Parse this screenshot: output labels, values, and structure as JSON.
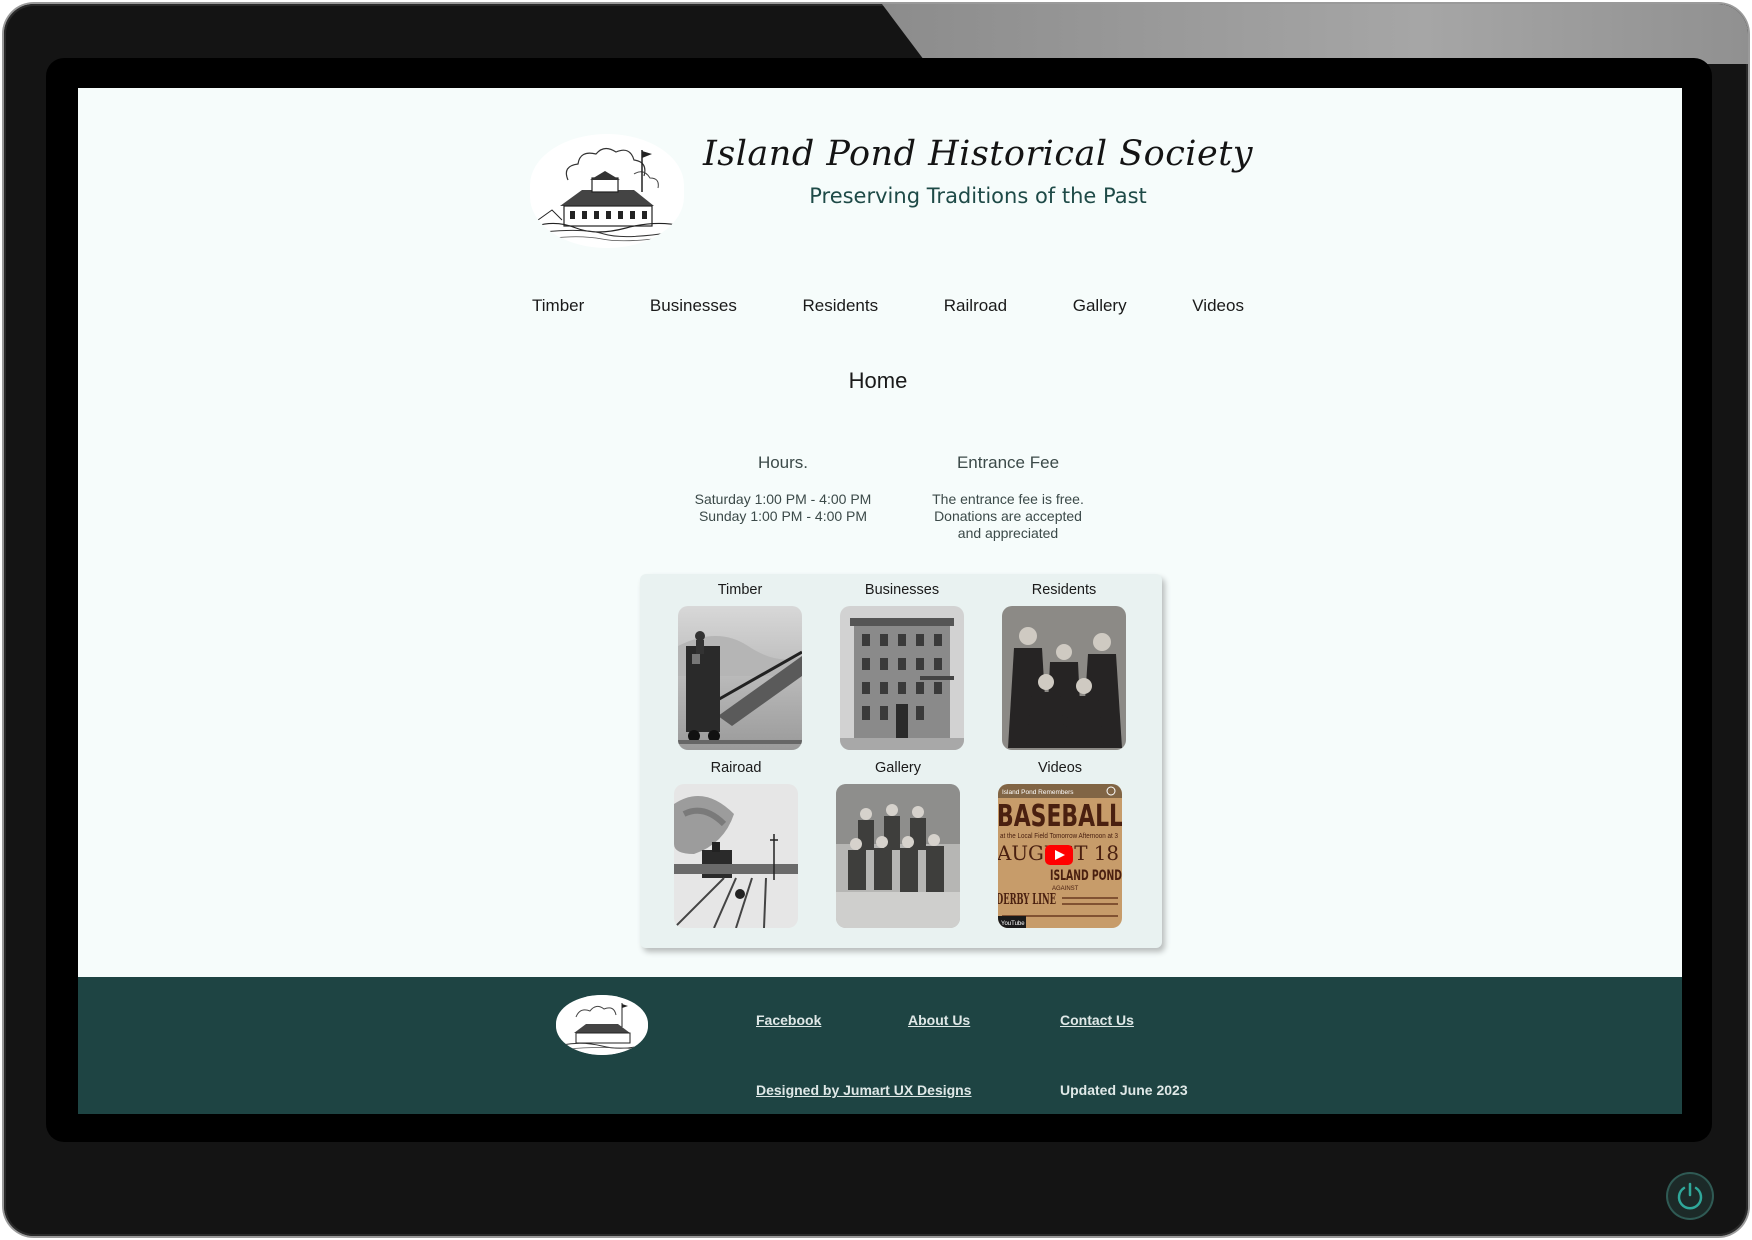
{
  "site": {
    "title": "Island Pond Historical Society",
    "subtitle": "Preserving Traditions of the Past"
  },
  "nav": {
    "items": [
      {
        "label": "Timber"
      },
      {
        "label": "Businesses"
      },
      {
        "label": "Residents"
      },
      {
        "label": "Railroad"
      },
      {
        "label": "Gallery"
      },
      {
        "label": "Videos"
      }
    ]
  },
  "page": {
    "heading": "Home"
  },
  "hours": {
    "title": "Hours.",
    "lines": [
      "Saturday 1:00 PM - 4:00 PM",
      "Sunday 1:00 PM - 4:00 PM"
    ]
  },
  "fee": {
    "title": "Entrance Fee",
    "lines": [
      "The entrance fee is free.",
      "Donations are accepted",
      "and appreciated"
    ]
  },
  "cards": [
    {
      "label": "Timber"
    },
    {
      "label": "Businesses"
    },
    {
      "label": "Residents"
    },
    {
      "label": "Rairoad"
    },
    {
      "label": "Gallery"
    },
    {
      "label": "Videos"
    }
  ],
  "video_thumb": {
    "channel": "Island Pond Remembers",
    "headline": "BASEBALL",
    "line1": "at the Local Field Tomorrow Afternoon at 3",
    "date": "AUGUST 18",
    "team": "ISLAND POND",
    "vs": "AGAINST",
    "opponent": "DERBY LINE",
    "badge": "YouTube"
  },
  "footer": {
    "facebook": "Facebook",
    "about": "About Us",
    "contact": "Contact Us",
    "designed_by": "Designed by Jumart UX Designs",
    "updated": "Updated June 2023"
  },
  "colors": {
    "accent": "#1e4443",
    "subtitle": "#1e4a47",
    "page_bg": "#f6fcfb",
    "card_panel": "#e9f2f1",
    "play_button": "#ff0000"
  }
}
